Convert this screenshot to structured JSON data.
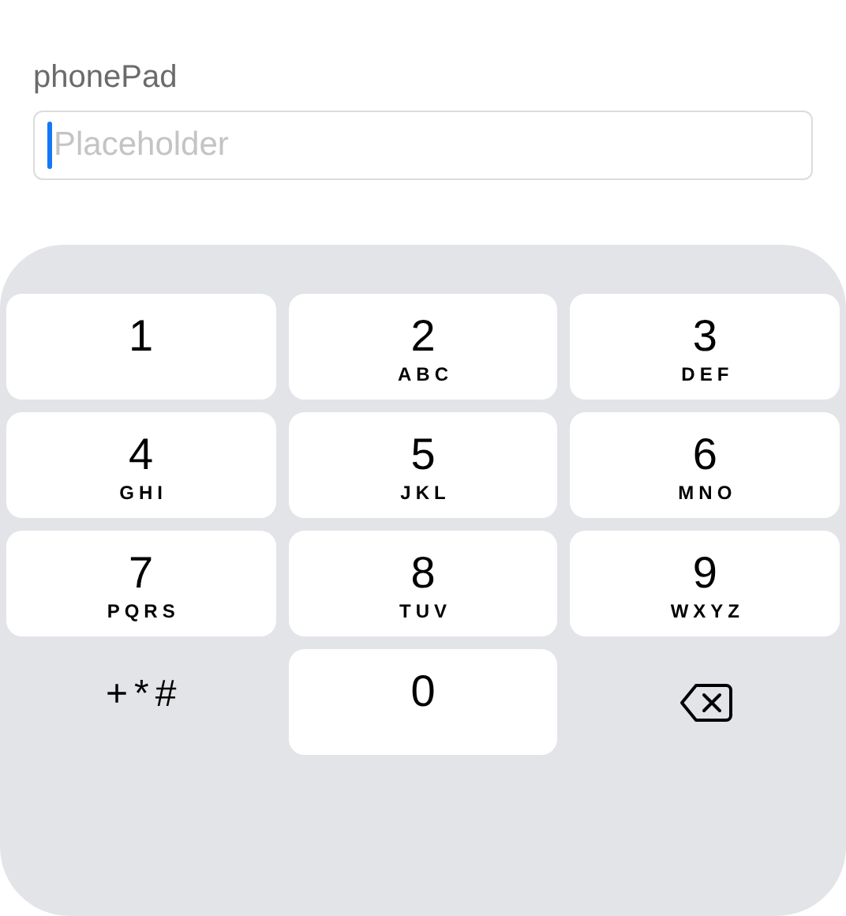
{
  "label": "phonePad",
  "field": {
    "placeholder": "Placeholder",
    "focused": true
  },
  "keys": [
    {
      "kind": "key",
      "digit": "1"
    },
    {
      "kind": "key",
      "digit": "2",
      "letters": "ABC"
    },
    {
      "kind": "key",
      "digit": "3",
      "letters": "DEF"
    },
    {
      "kind": "key",
      "digit": "4",
      "letters": "GHI"
    },
    {
      "kind": "key",
      "digit": "5",
      "letters": "JKL"
    },
    {
      "kind": "key",
      "digit": "6",
      "letters": "MNO"
    },
    {
      "kind": "key",
      "digit": "7",
      "letters": "PQRS"
    },
    {
      "kind": "key",
      "digit": "8",
      "letters": "TUV"
    },
    {
      "kind": "key",
      "digit": "9",
      "letters": "WXYZ"
    },
    {
      "kind": "symbols",
      "text": "+*#"
    },
    {
      "kind": "key",
      "digit": "0"
    },
    {
      "kind": "delete"
    }
  ]
}
